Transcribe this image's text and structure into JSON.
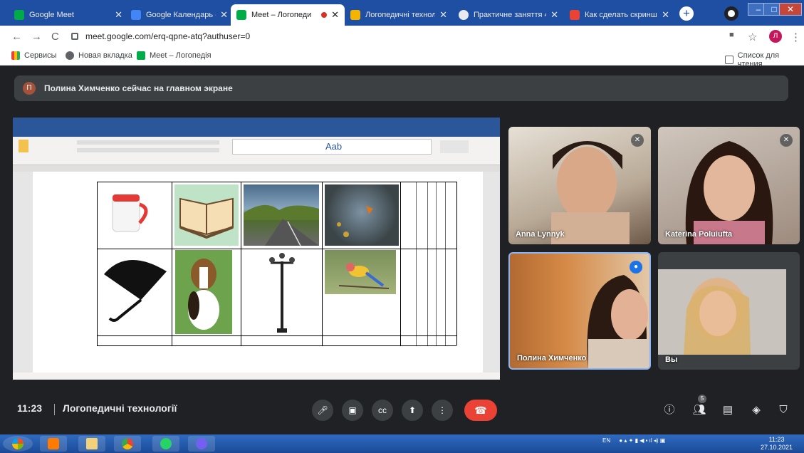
{
  "tabs": [
    {
      "label": "Google Meet"
    },
    {
      "label": "Google Календарь - Н"
    },
    {
      "label": "Meet – Логопеди"
    },
    {
      "label": "Логопедичні техноло"
    },
    {
      "label": "Практичне заняття 4."
    },
    {
      "label": "Как сделать скриншо"
    }
  ],
  "address": {
    "url": "meet.google.com/erq-qpne-atq?authuser=0"
  },
  "bookmarks": {
    "apps": "Сервисы",
    "newtab": "Новая вкладка",
    "meet": "Meet – Логопедія",
    "reading_list": "Список для чтения"
  },
  "profile": {
    "initial": "Л"
  },
  "banner": {
    "initial": "П",
    "text": "Полина Химченко сейчас на главном экране"
  },
  "participants": [
    {
      "name": "Anna Lynnyk"
    },
    {
      "name": "Katerina Poluiufta"
    },
    {
      "name": "Полина Химченко"
    },
    {
      "name": "Вы"
    }
  ],
  "controls": {
    "time": "11:23",
    "title": "Логопедичні технології",
    "participant_count": "5"
  },
  "word": {
    "heading": "Aab"
  },
  "taskbar": {
    "lang": "EN",
    "time": "11:23",
    "date": "27.10.2021"
  },
  "colors": {
    "meet_bg": "#202124",
    "hangup": "#ea4335",
    "word_blue": "#2b579a",
    "tabstrip": "#1f4fa3"
  }
}
